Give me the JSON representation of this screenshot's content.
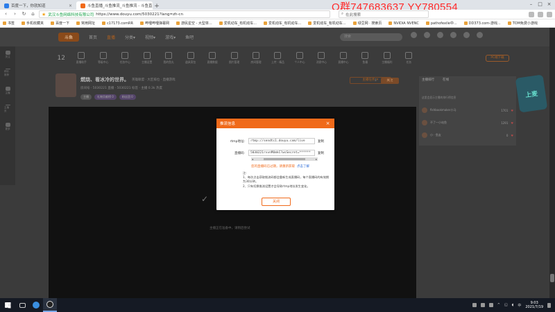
{
  "browser": {
    "tabs": [
      {
        "title": "百度一下，你就知道",
        "active": false
      },
      {
        "title": "斗鱼直播_斗鱼推流_斗鱼推流 - 斗鱼直...",
        "active": true
      }
    ],
    "url_secure_label": "武汉斗鱼网络科技有限公司",
    "url": "https://www.douyu.com/5030221?lang=zh-cn",
    "search_placeholder": "在此搜索",
    "watermark": "Q群747683637    YY780554"
  },
  "bookmarks": [
    "书签",
    "手机收藏夹",
    "百度一下",
    "常用网址",
    "c17173.comRR",
    "哔哩哔哩弹幕网",
    "游民星空 - 大型单...",
    "爱机动车_有机动车...",
    "爱机动车_有机动车...",
    "爱机动车_有机动车...",
    "绿豆网 · 搜索页",
    "NVIDIA NVENC",
    "pathofexile中...",
    "DD373.com-游戏...",
    "TOM免费小游戏"
  ],
  "site": {
    "logo": "斗鱼",
    "nav": [
      {
        "label": "首页",
        "active": false
      },
      {
        "label": "直播",
        "active": true
      },
      {
        "label": "分类▾",
        "active": false
      },
      {
        "label": "视频▾",
        "active": false
      },
      {
        "label": "游戏▾",
        "active": false
      },
      {
        "label": "鱼吧",
        "active": false
      }
    ],
    "search_placeholder": "搜索",
    "left_rail": [
      "关注",
      "精彩推荐",
      "主播",
      "主播页",
      "更多"
    ],
    "func_count": "12",
    "funcs": [
      "直播助手",
      "等级中心",
      "任务中心",
      "主播设置",
      "我的鱼丸",
      "道具背包",
      "直播数据",
      "图片管理",
      "房间管理",
      "上传 · 精品",
      "个人中心",
      "消息中心",
      "直播中心",
      "鱼塘",
      "主播福利",
      "任务",
      "活动"
    ],
    "pc_button": "PC端下载",
    "room": {
      "title": "燃烧、看冰冷的世界。",
      "category": "英雄联盟 · 大区排位 · 直播游戏",
      "meta": "房间号 · 5030221    直播 · 5030221    标签 · 主播    0.3k 热度",
      "tags": [
        "主播",
        "礼物贡献榜 0",
        "粉丝团 0"
      ],
      "follow_count": "1",
      "follow_label": "关注",
      "ads_label": "主播任务 ✕"
    },
    "video_hint": "主播正在准备中，请稍后尝试"
  },
  "rank": {
    "tabs": [
      "主播排行",
      "在线"
    ],
    "tip": "这里会显示主播的排行榜信息",
    "rows": [
      {
        "name": "fishbookmaker小马",
        "value": "1701"
      },
      {
        "name": "不了一小站鱼",
        "value": "1291"
      },
      {
        "name": "小 · 鱼友",
        "value": "0"
      }
    ],
    "promo": "上麦"
  },
  "modal": {
    "title": "推流信息",
    "rtmp_label": "rtmp地址:",
    "rtmp_value": "rtmp://sendtc1.douyu.com/live",
    "key_label": "直播码:",
    "key_value": "5030221rvvnMUmkC?wsSecret=******",
    "copy_label": "复制",
    "warning": "您的直播码已过期，请重新获取",
    "learn_more": "点击了解",
    "notes_title": "注:",
    "note1": "1、每次点击获取推流码都会重新生成直播码，每个直播码的有效期为30分钟。",
    "note2": "2、只有切换推流设置才会导致rtmp地址发生变化。",
    "confirm": "关闭"
  },
  "taskbar": {
    "time": "9:03",
    "date": "2021/7/19",
    "lang": "中"
  }
}
